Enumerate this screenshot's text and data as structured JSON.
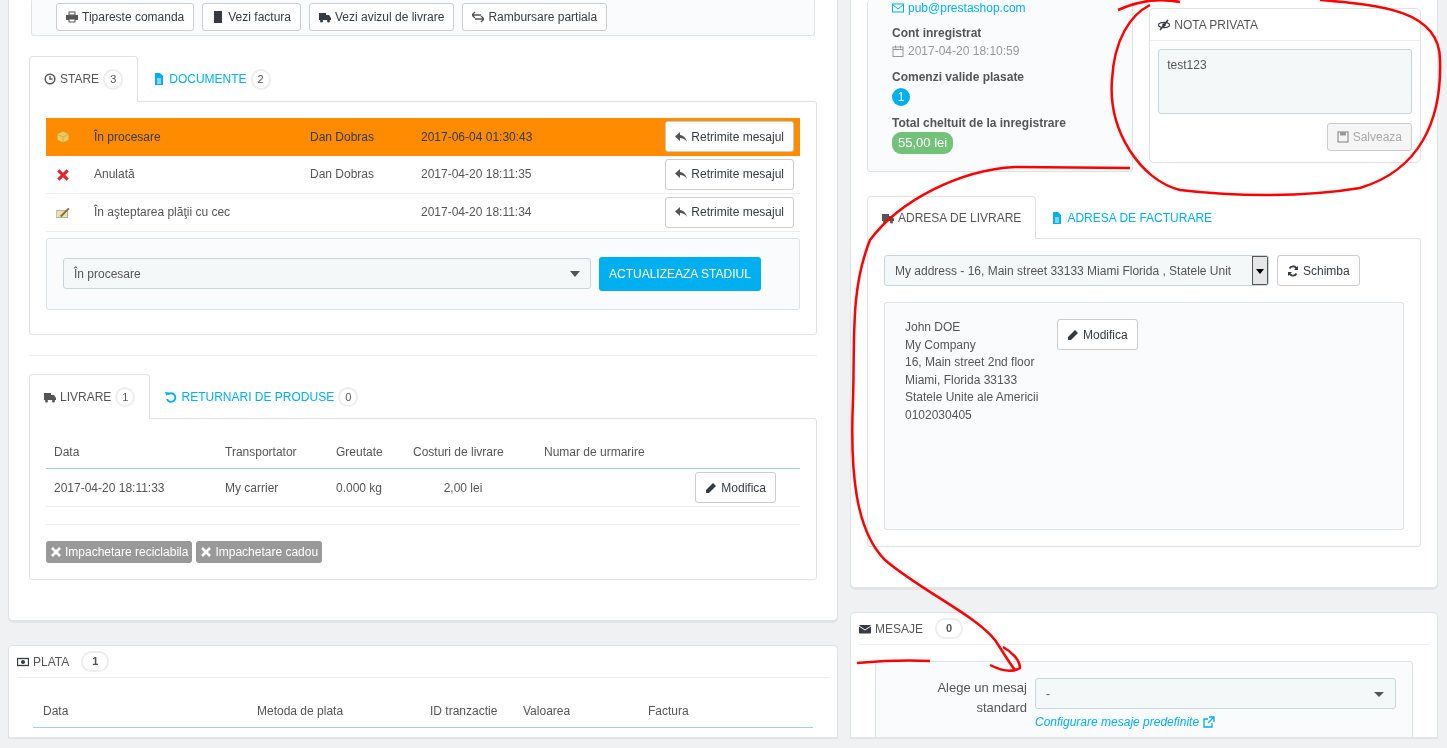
{
  "order_actions": [
    "Tipareste comanda",
    "Vezi factura",
    "Vezi avizul de livrare",
    "Rambursare partiala"
  ],
  "status_tabs": [
    {
      "label": "STARE",
      "count": "3",
      "selected": true
    },
    {
      "label": "DOCUMENTE",
      "count": "2",
      "selected": false
    }
  ],
  "history": [
    {
      "kind": "processing",
      "status": "În procesare",
      "employee": "Dan Dobras",
      "date": "2017-06-04 01:30:43",
      "current": true,
      "action": "Retrimite mesajul"
    },
    {
      "kind": "cancelled",
      "status": "Anulată",
      "employee": "Dan Dobras",
      "date": "2017-04-20 18:11:35",
      "current": false,
      "action": "Retrimite mesajul"
    },
    {
      "kind": "awaiting",
      "status": "În aşteptarea plăţii cu cec",
      "date": "2017-04-20 18:11:34",
      "current": false,
      "action": "Retrimite mesajul"
    }
  ],
  "status_select": {
    "value": "În procesare"
  },
  "update_button": "ACTUALIZEAZA STADIUL",
  "shipping_tabs": [
    {
      "label": "LIVRARE",
      "count": "1",
      "selected": true
    },
    {
      "label": "RETURNARI DE PRODUSE",
      "count": "0",
      "selected": false
    }
  ],
  "shipping_table": {
    "columns": [
      "Data",
      "Transportator",
      "Greutate",
      "Costuri de livrare",
      "Numar de urmarire"
    ],
    "rows": [
      {
        "cells": [
          "2017-04-20 18:11:33",
          "My carrier",
          "0.000 kg",
          "2,00 lei",
          ""
        ],
        "action": "Modifica"
      }
    ]
  },
  "options": [
    "Impachetare reciclabila",
    "Impachetare cadou"
  ],
  "payment": {
    "title": "PLATA",
    "count": "1",
    "columns": [
      "Data",
      "Metoda de plata",
      "ID tranzactie",
      "Valoarea",
      "Factura"
    ]
  },
  "customer": {
    "email": "pub@prestashop.com",
    "registered_label": "Cont inregistrat",
    "registered_date": "2017-04-20 18:10:59",
    "orders_label": "Comenzi valide plasate",
    "orders_count": "1",
    "total_label": "Total cheltuit de la inregistrare",
    "total": "55,00 lei"
  },
  "private_note": {
    "title": "NOTA PRIVATA",
    "text": "test123",
    "save": "Salveaza",
    "save_disabled": true
  },
  "address_tabs": [
    {
      "label": "ADRESA DE LIVRARE",
      "selected": true
    },
    {
      "label": "ADRESA DE FACTURARE",
      "selected": false
    }
  ],
  "address_select": {
    "value": "My address - 16, Main street 33133 Miami Florida , Statele Unit"
  },
  "change_button": "Schimba",
  "address_lines": [
    "John DOE",
    "My Company",
    "16, Main street 2nd floor",
    "Miami, Florida 33133",
    "Statele Unite ale Americii",
    "0102030405"
  ],
  "edit_button": "Modifica",
  "messages": {
    "title": "MESAJE",
    "count": "0",
    "label": "Alege un mesaj standard",
    "select_value": "-",
    "link": "Configurare mesaje predefinite"
  }
}
